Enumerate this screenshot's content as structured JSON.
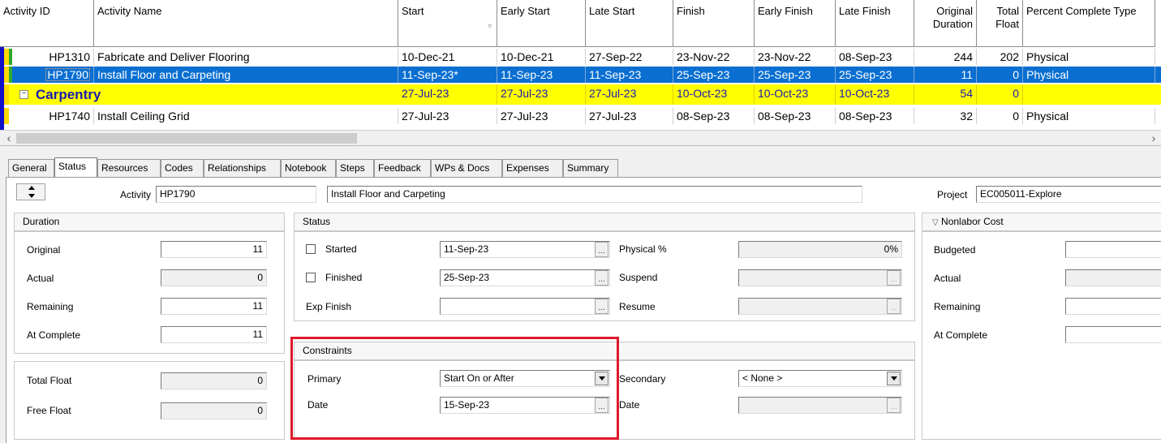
{
  "grid": {
    "columns": [
      "Activity ID",
      "Activity Name",
      "Start",
      "Early Start",
      "Late Start",
      "Finish",
      "Early Finish",
      "Late Finish",
      "Original Duration",
      "Total Float",
      "Percent Complete Type"
    ],
    "rows": [
      {
        "id": "HP1310",
        "name": "Fabricate and Deliver Flooring",
        "start": "10-Dec-21",
        "early_start": "10-Dec-21",
        "late_start": "27-Sep-22",
        "finish": "23-Nov-22",
        "early_finish": "23-Nov-22",
        "late_finish": "08-Sep-23",
        "orig_dur": "244",
        "total_float": "202",
        "pct_type": "Physical"
      },
      {
        "id": "HP1790",
        "name": "Install Floor and Carpeting",
        "start": "11-Sep-23*",
        "early_start": "11-Sep-23",
        "late_start": "11-Sep-23",
        "finish": "25-Sep-23",
        "early_finish": "25-Sep-23",
        "late_finish": "25-Sep-23",
        "orig_dur": "11",
        "total_float": "0",
        "pct_type": "Physical"
      },
      {
        "band": true,
        "name": "Carpentry",
        "start": "27-Jul-23",
        "early_start": "27-Jul-23",
        "late_start": "27-Jul-23",
        "finish": "10-Oct-23",
        "early_finish": "10-Oct-23",
        "late_finish": "10-Oct-23",
        "orig_dur": "54",
        "total_float": "0"
      },
      {
        "id": "HP1740",
        "name": "Install Ceiling Grid",
        "start": "27-Jul-23",
        "early_start": "27-Jul-23",
        "late_start": "27-Jul-23",
        "finish": "08-Sep-23",
        "early_finish": "08-Sep-23",
        "late_finish": "08-Sep-23",
        "orig_dur": "32",
        "total_float": "0",
        "pct_type": "Physical"
      }
    ]
  },
  "tabs": [
    "General",
    "Status",
    "Resources",
    "Codes",
    "Relationships",
    "Notebook",
    "Steps",
    "Feedback",
    "WPs & Docs",
    "Expenses",
    "Summary"
  ],
  "activity": {
    "label": "Activity",
    "id": "HP1790",
    "name": "Install Floor and Carpeting",
    "project_label": "Project",
    "project": "EC005011-Explore"
  },
  "duration": {
    "title": "Duration",
    "original_label": "Original",
    "original": "11",
    "actual_label": "Actual",
    "actual": "0",
    "remaining_label": "Remaining",
    "remaining": "11",
    "at_complete_label": "At Complete",
    "at_complete": "11"
  },
  "float": {
    "total_label": "Total Float",
    "total": "0",
    "free_label": "Free Float",
    "free": "0"
  },
  "status": {
    "title": "Status",
    "started_label": "Started",
    "started": "11-Sep-23",
    "finished_label": "Finished",
    "finished": "25-Sep-23",
    "exp_finish_label": "Exp Finish",
    "exp_finish": "",
    "physical_label": "Physical %",
    "physical": "0%",
    "suspend_label": "Suspend",
    "resume_label": "Resume"
  },
  "constraints": {
    "title": "Constraints",
    "primary_label": "Primary",
    "primary": "Start On or After",
    "date_label": "Date",
    "date": "15-Sep-23",
    "secondary_label": "Secondary",
    "secondary": "< None >",
    "date2_label": "Date"
  },
  "nonlabor": {
    "title": "Nonlabor Cost",
    "budgeted_label": "Budgeted",
    "actual_label": "Actual",
    "remaining_label": "Remaining",
    "at_complete_label": "At Complete"
  },
  "colors": {
    "selection": "#0a6fd1",
    "band": "#ffff00",
    "band_text": "#1a1ab4",
    "highlight": "#e0182a"
  }
}
